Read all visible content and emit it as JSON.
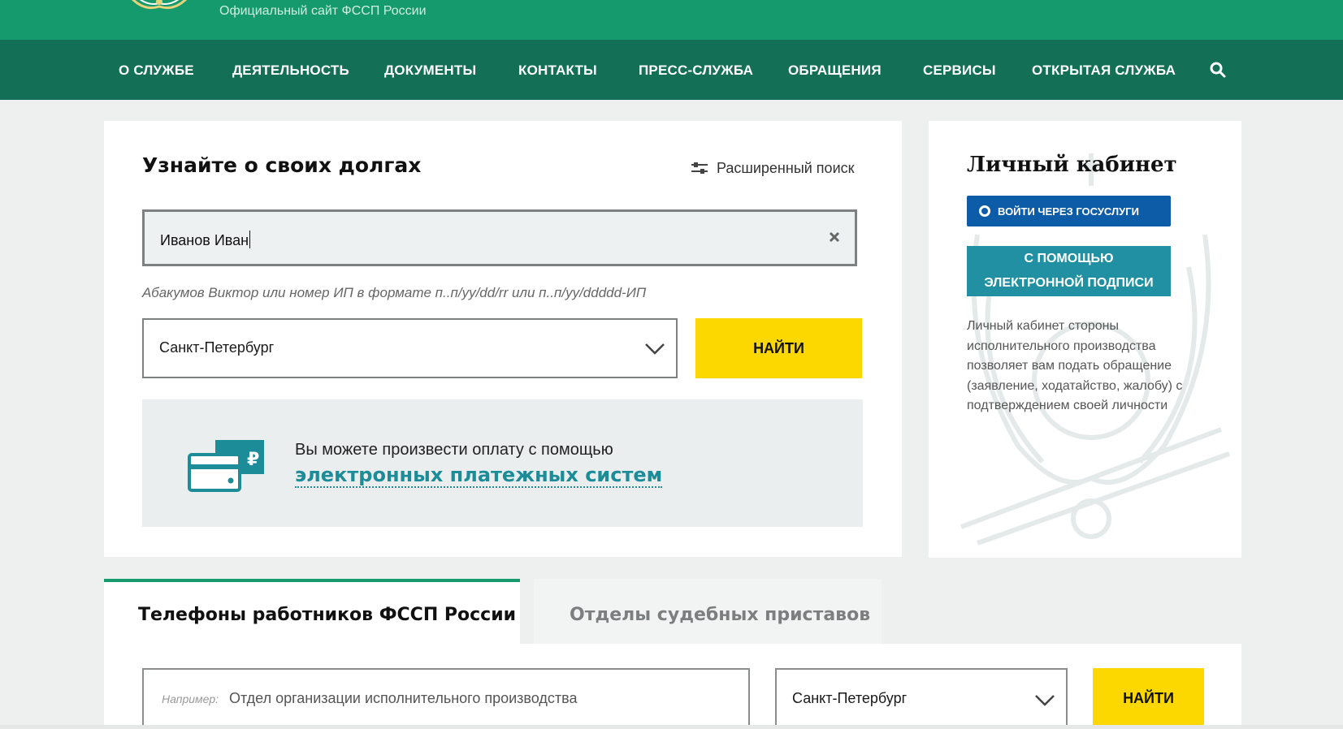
{
  "header": {
    "site_title": "Официальный сайт ФССП России",
    "logo_icon": "fssp-emblem-icon"
  },
  "nav": {
    "items": [
      {
        "label": "О СЛУЖБЕ"
      },
      {
        "label": "ДЕЯТЕЛЬНОСТЬ"
      },
      {
        "label": "ДОКУМЕНТЫ"
      },
      {
        "label": "КОНТАКТЫ"
      },
      {
        "label": "ПРЕСС-СЛУЖБА"
      },
      {
        "label": "ОБРАЩЕНИЯ"
      },
      {
        "label": "СЕРВИСЫ"
      },
      {
        "label": "ОТКРЫТАЯ СЛУЖБА"
      }
    ],
    "search_icon": "search-icon"
  },
  "debt_search": {
    "title": "Узнайте о своих долгах",
    "advanced_search_label": "Расширенный поиск",
    "name_value": "Иванов Иван",
    "hint": "Абакумов Виктор или номер ИП в формате п..п/yy/dd/rr или п..п/yy/ddddd-ИП",
    "region_value": "Санкт-Петербург",
    "find_button": "НАЙТИ"
  },
  "payment": {
    "text": "Вы можете произвести оплату с помощью",
    "link": "электронных платежных систем",
    "icon": "payment-card-icon"
  },
  "cabinet": {
    "title": "Личный кабинет",
    "gosuslugi_button": "ВОЙТИ ЧЕРЕЗ ГОСУСЛУГИ",
    "esign_button_line1": "С ПОМОЩЬЮ",
    "esign_button_line2": "ЭЛЕКТРОННОЙ ПОДПИСИ",
    "description": "Личный кабинет стороны исполнительного производства позволяет вам подать обращение (заявление, ходатайство, жалобу) с подтверждением своей личности"
  },
  "tabs": [
    {
      "label": "Телефоны работников ФССП России",
      "active": true
    },
    {
      "label": "Отделы судебных приставов",
      "active": false
    }
  ],
  "dept_search": {
    "placeholder_prefix": "Например:",
    "placeholder": "Отдел организации исполнительного производства",
    "region_value": "Санкт-Петербург",
    "find_button": "НАЙТИ"
  },
  "colors": {
    "header_green": "#159a6e",
    "nav_green": "#136f55",
    "find_yellow": "#fcd800",
    "gosuslugi_blue": "#0d5ca8",
    "esign_teal": "#2090a2",
    "link_teal": "#1b8c98"
  }
}
